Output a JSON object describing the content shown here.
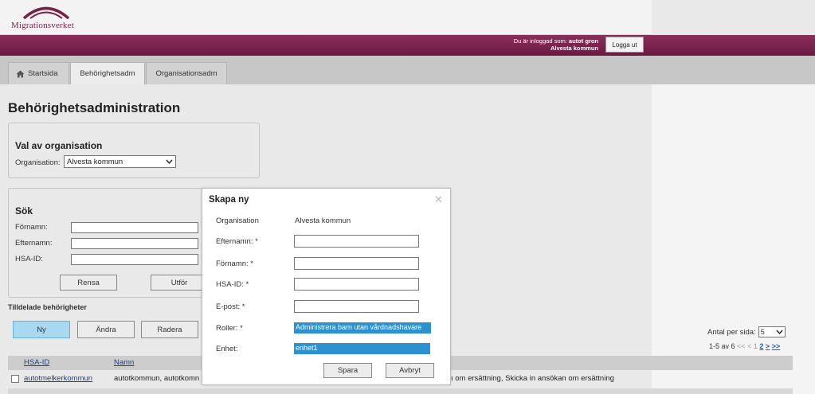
{
  "header": {
    "logo_text": "Migrationsverket",
    "user_label": "Du är inloggad som:",
    "user_name": "autot gron",
    "user_org": "Alvesta kommun",
    "logout_label": "Logga ut"
  },
  "tabs": [
    {
      "label": "Startsida",
      "icon": "home-icon"
    },
    {
      "label": "Behörighetsadm"
    },
    {
      "label": "Organisationsadm"
    }
  ],
  "page": {
    "title": "Behörighetsadministration"
  },
  "org_select_box": {
    "title": "Val av organisation",
    "label": "Organisation:",
    "value": "Alvesta kommun"
  },
  "search": {
    "title": "Sök",
    "fields": [
      {
        "label": "Förnamn:",
        "value": ""
      },
      {
        "label": "Efternamn:",
        "value": ""
      },
      {
        "label": "HSA-ID:",
        "value": ""
      }
    ],
    "reset_label": "Rensa",
    "submit_label": "Utför"
  },
  "assigned": {
    "title": "Tilldelade behörigheter",
    "new_label": "Ny",
    "edit_label": "Ändra",
    "delete_label": "Radera",
    "per_page_label": "Antal per sida:",
    "per_page_value": "5",
    "pager_text": "1-5 av 6",
    "pager_first": "<<",
    "pager_prev": "<",
    "pager_current": "1",
    "pager_page2": "2",
    "pager_next": ">",
    "pager_last": ">>",
    "columns": [
      "HSA-ID",
      "Namn"
    ],
    "rows": [
      {
        "hsa_id": "autotmelkerkommun",
        "name": "autotkommun, autotkomn",
        "roles_tail": "ı om ersättning, Skicka in ansökan om ersättning"
      }
    ]
  },
  "dialog": {
    "title": "Skapa ny",
    "org_label": "Organisation",
    "org_value": "Alvesta kommun",
    "lastname_label": "Efternamn: *",
    "firstname_label": "Förnamn: *",
    "hsa_label": "HSA-ID: *",
    "email_label": "E-post: *",
    "roles_label": "Roller: *",
    "roles_value": "Administrera barn utan vårdnadshavare",
    "unit_label": "Enhet:",
    "unit_value": "enhet1",
    "save_label": "Spara",
    "cancel_label": "Avbryt"
  },
  "colors": {
    "brand": "#7a1f45",
    "selection": "#2d91d0",
    "primary_button": "#a8d9f0"
  }
}
